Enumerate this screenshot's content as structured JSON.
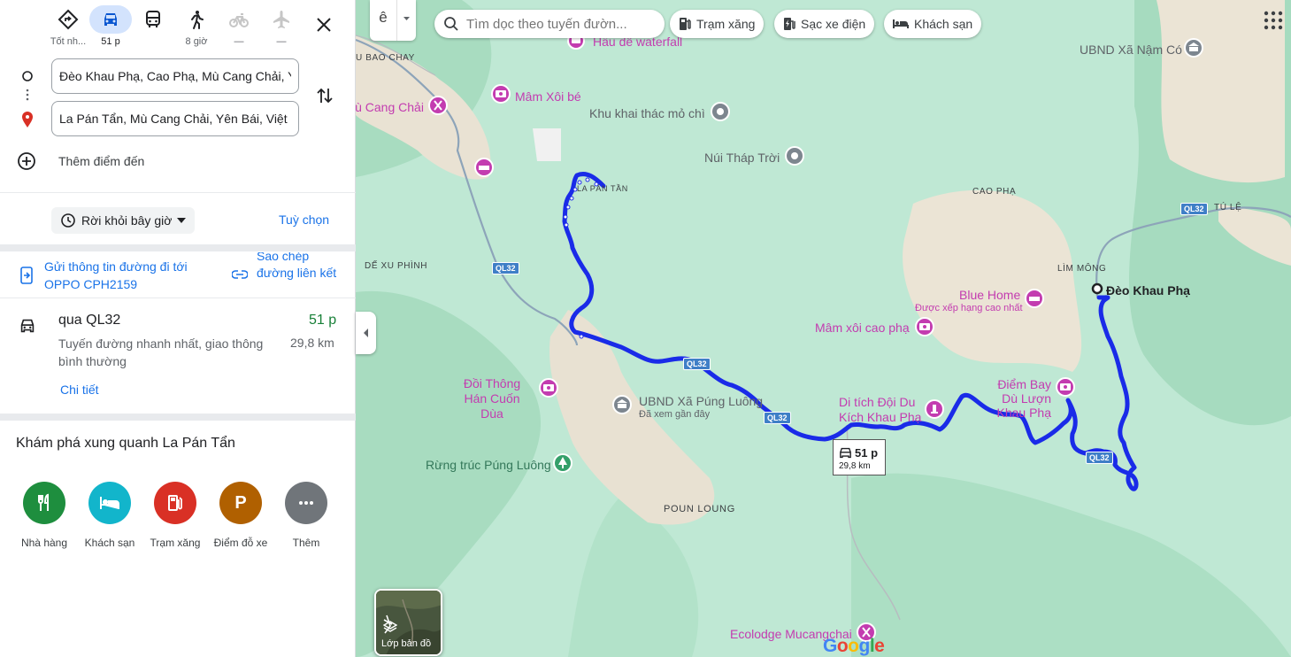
{
  "panel": {
    "modes": [
      {
        "name": "best",
        "label": "Tốt nh...",
        "icon": "directions-icon"
      },
      {
        "name": "car",
        "label": "51 p",
        "icon": "car-icon"
      },
      {
        "name": "transit",
        "label": "",
        "icon": "bus-icon"
      },
      {
        "name": "walk",
        "label": "8 giờ",
        "icon": "walk-icon"
      },
      {
        "name": "bike",
        "label": "—",
        "icon": "bike-icon"
      },
      {
        "name": "flight",
        "label": "—",
        "icon": "plane-icon"
      }
    ],
    "origin_value": "Đèo Khau Phạ, Cao Phạ, Mù Cang Chải, Y",
    "destination_value": "La Pán Tẩn, Mù Cang Chải, Yên Bái, Việt N",
    "add_destination_label": "Thêm điểm đến",
    "depart_label": "Rời khỏi bây giờ",
    "options_label": "Tuỳ chọn",
    "send_label": "Gửi thông tin đường đi tới OPPO CPH2159",
    "copy_label": "Sao chép đường liên kết",
    "route": {
      "via": "qua QL32",
      "duration": "51 p",
      "description": "Tuyến đường nhanh nhất, giao thông bình thường",
      "distance": "29,8 km",
      "details_label": "Chi tiết"
    },
    "explore_title": "Khám phá xung quanh La Pán Tẩn",
    "categories": [
      {
        "label": "Nhà hàng",
        "icon": "restaurant-icon",
        "color": "#1e8e3e"
      },
      {
        "label": "Khách sạn",
        "icon": "hotel-icon",
        "color": "#12b5cb"
      },
      {
        "label": "Trạm xăng",
        "icon": "gas-station-icon",
        "color": "#d93025"
      },
      {
        "label": "Điểm đỗ xe",
        "icon": "parking-icon",
        "color": "#b06000"
      },
      {
        "label": "Thêm",
        "icon": "more-icon",
        "color": "#70757a"
      }
    ]
  },
  "map": {
    "lang_label": "ê",
    "search_placeholder": "Tìm dọc theo tuyến đườn...",
    "chips": [
      {
        "label": "Trạm xăng",
        "icon": "gas-station-icon"
      },
      {
        "label": "Sạc xe điện",
        "icon": "ev-charger-icon"
      },
      {
        "label": "Khách sạn",
        "icon": "hotel-icon"
      }
    ],
    "labels": {
      "hau_de": "Hầu dê waterfall",
      "ubnd_nam_co": "UBND Xã Nậm Có",
      "bao_chay": "U BAO CHAY",
      "mu_cang_chai": "lù Cang Chải",
      "mam_xoi_be": "Mâm Xôi bé",
      "khu_khai_thac": "Khu khai thác mỏ chì",
      "nui_thap_troi": "Núi Tháp Trời",
      "la_pan_tan": "LA PÁN TẦN",
      "cao_pha": "CAO PHẠ",
      "tu_le": "TÚ LỆ",
      "de_xu_phinh": "DẾ XU PHÌNH",
      "lim_mong": "LÌM MÔNG",
      "deo_khau_pha": "Đèo Khau Phạ",
      "blue_home": "Blue Home",
      "blue_home_sub": "Được xếp hạng cao nhất",
      "mam_xoi_cao_pha": "Mâm xôi cao phạ",
      "diem_bay_du": "Điểm Bay Dù Lượn Khau Phạ",
      "doi_thong": "Đồi Thông Hán Cuốn Dùa",
      "ubnd_pung_luong": "UBND Xã Púng Luông",
      "ubnd_pung_luong_sub": "Đã xem gần đây",
      "di_tich": "Di tích Đội Du Kích Khau Phạ",
      "rung_truc": "Rừng trúc Púng Luông",
      "poun_loung": "POUN LOUNG",
      "ecolodge": "Ecolodge Mucangchai"
    },
    "shields": [
      "QL32",
      "QL32",
      "QL32",
      "QL32",
      "QL32"
    ],
    "duration_box": {
      "duration": "51 p",
      "distance": "29,8 km"
    },
    "layers_label": "Lớp bản đồ",
    "google_logo": "Google"
  },
  "colors": {
    "route": "#1a2be8",
    "accent": "#1a73e8",
    "poi_pink": "#c33cb0",
    "green": "#188038"
  }
}
